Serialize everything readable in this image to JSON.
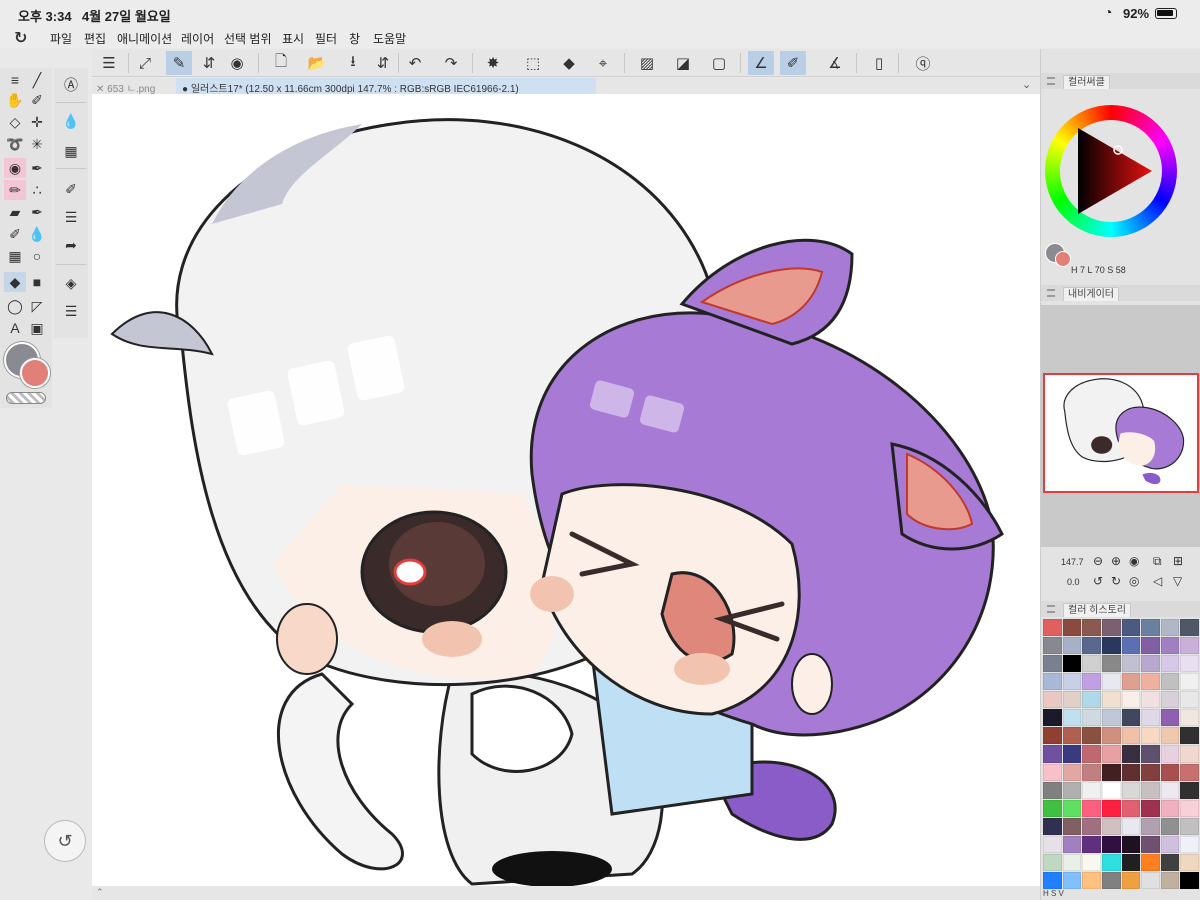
{
  "status": {
    "time": "오후 3:34",
    "date": "4월 27일 월요일",
    "battery": "92%"
  },
  "menu": [
    "파일",
    "편집",
    "애니메이션",
    "레이어",
    "선택 범위",
    "표시",
    "필터",
    "창",
    "도움말"
  ],
  "tabs": {
    "inactive": "653 ㄴ.png",
    "active": "일러스트17* (12.50 x 11.66cm 300dpi 147.7% : RGB:sRGB IEC61966-2.1)"
  },
  "colors": {
    "main": "#8a8a93",
    "sub": "#e08078",
    "accent": "#b9cfe6"
  },
  "panels": {
    "color_circle": "컬러써클",
    "navigator": "내비게이터",
    "color_history": "컬러 히스토리"
  },
  "hsv": {
    "h_label": "H",
    "h": "7",
    "l_label": "L",
    "l": "70",
    "s_label": "S",
    "s": "58"
  },
  "navigator": {
    "zoom": "147.7",
    "angle": "0.0"
  },
  "tool_letter": "A",
  "palette_foot": "H S V",
  "palette": [
    "#e06060",
    "#8a4a40",
    "#8a5a50",
    "#7a6070",
    "#4a5a80",
    "#6a80a0",
    "#b0b8c8",
    "#505868",
    "#888890",
    "#a8b0c8",
    "#5a6890",
    "#2a3860",
    "#5a70b0",
    "#8060a0",
    "#a080c0",
    "#c8b0d8",
    "#7a8090",
    "#000000",
    "#d0d0d0",
    "#888888",
    "#c0c0d0",
    "#b8a8d0",
    "#d8c8e8",
    "#e8e0f0",
    "#a8b8d8",
    "#c8d0e8",
    "#c0a0e0",
    "#e8e8f0",
    "#e0a090",
    "#f0b0a0",
    "#c0c0c0",
    "#f0f0f0",
    "#e8c8c0",
    "#e0d0c8",
    "#b0d8e8",
    "#f0e0d0",
    "#f8f0e8",
    "#f0e0e0",
    "#d8d0d8",
    "#e8e8e8",
    "#1a1a2a",
    "#c0e0f0",
    "#d0d8e0",
    "#c0c8d8",
    "#404860",
    "#e0d8e8",
    "#9060b0",
    "#f0e8e0",
    "#904030",
    "#b06050",
    "#8a5040",
    "#d09080",
    "#f0c0a8",
    "#f8d8c0",
    "#f0c8b0",
    "#303030",
    "#7050a0",
    "#3a3a80",
    "#c06870",
    "#e8a0a0",
    "#383040",
    "#605070",
    "#e8d0e0",
    "#f0d8d0",
    "#f8c0c8",
    "#e0a8a0",
    "#c08080",
    "#402020",
    "#603030",
    "#804040",
    "#a85050",
    "#c87070",
    "#808080",
    "#b0b0b0",
    "#f0f0f0",
    "#ffffff",
    "#d8d8d8",
    "#c8c0c0",
    "#f0e8f0",
    "#303030",
    "#40c040",
    "#60e060",
    "#ff6080",
    "#ff2040",
    "#e06070",
    "#a03050",
    "#f0b0c0",
    "#f8d0d8",
    "#303050",
    "#806060",
    "#a07080",
    "#d0c0c0",
    "#e8e8f0",
    "#b0a0b0",
    "#909090",
    "#c0c0c0",
    "#e8e0e8",
    "#a080c0",
    "#603080",
    "#301040",
    "#201020",
    "#705070",
    "#d0c0e0",
    "#f0f0f8",
    "#c0d8c0",
    "#e8f0e8",
    "#f8f8f0",
    "#30e0e0",
    "#202020",
    "#ff8020",
    "#404040",
    "#f0d8c0",
    "#2080ff",
    "#80c0ff",
    "#ffc080",
    "#808080",
    "#f0a040",
    "#e0e0e0",
    "#c0b0a0",
    "#000000"
  ]
}
